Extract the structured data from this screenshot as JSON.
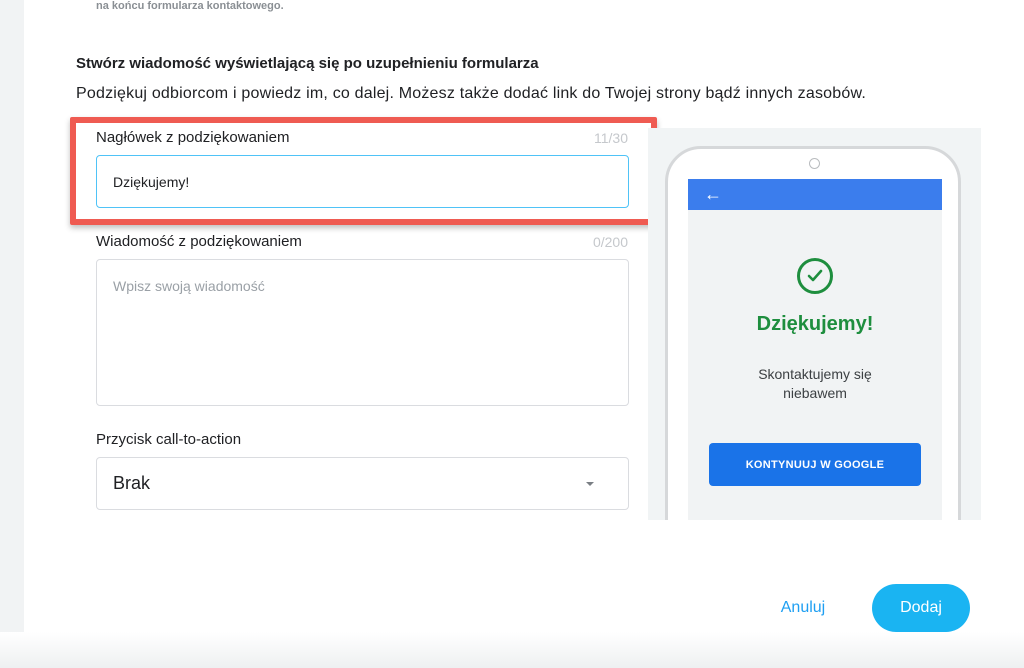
{
  "top_note": "na końcu formularza kontaktowego.",
  "section": {
    "title": "Stwórz wiadomość wyświetlającą się po uzupełnieniu formularza",
    "description": "Podziękuj odbiorcom i powiedz im, co dalej. Możesz także dodać link do Twojej strony bądź innych zasobów."
  },
  "heading_field": {
    "label": "Nagłówek z podziękowaniem",
    "counter": "11/30",
    "value": "Dziękujemy!"
  },
  "message_field": {
    "label": "Wiadomość z podziękowaniem",
    "counter": "0/200",
    "placeholder": "Wpisz swoją wiadomość"
  },
  "cta_field": {
    "label": "Przycisk call-to-action",
    "selected": "Brak"
  },
  "preview": {
    "back_arrow": "←",
    "title": "Dziękujemy!",
    "message": "Skontaktujemy się niebawem",
    "cta_label": "KONTYNUUJ W GOOGLE"
  },
  "actions": {
    "cancel_label": "Anuluj",
    "add_label": "Dodaj"
  },
  "colors": {
    "accent": "#1ab4f2",
    "highlight": "#ef5b52",
    "success": "#1e8e3e",
    "phone_bar": "#3b7ded"
  }
}
